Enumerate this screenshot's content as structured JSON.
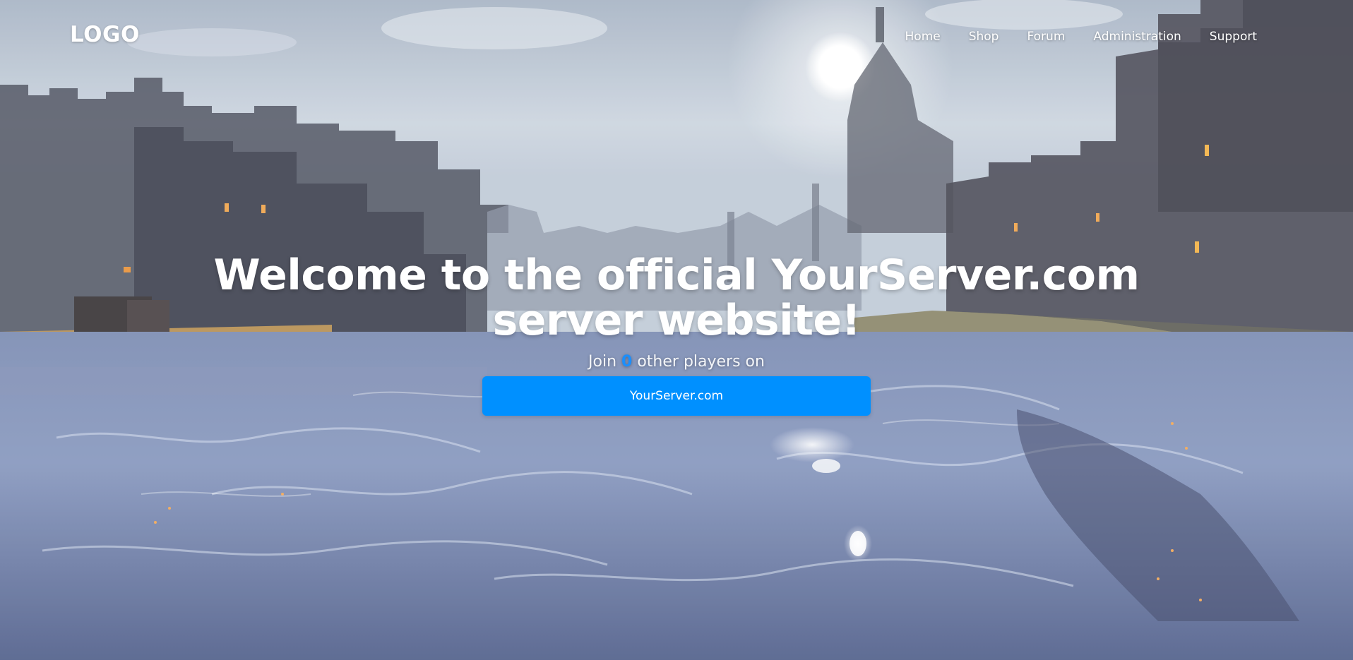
{
  "header": {
    "logo": "LOGO",
    "nav": [
      {
        "label": "Home"
      },
      {
        "label": "Shop"
      },
      {
        "label": "Forum"
      },
      {
        "label": "Administration"
      },
      {
        "label": "Support"
      }
    ]
  },
  "hero": {
    "title": "Welcome to the official YourServer.com server website!",
    "subtitle_before": "Join",
    "player_count": "0",
    "subtitle_after": "other players on",
    "ip_button_label": "YourServer.com"
  },
  "colors": {
    "accent": "#0090ff",
    "player_count": "#1a8fff",
    "text": "#ffffff"
  }
}
